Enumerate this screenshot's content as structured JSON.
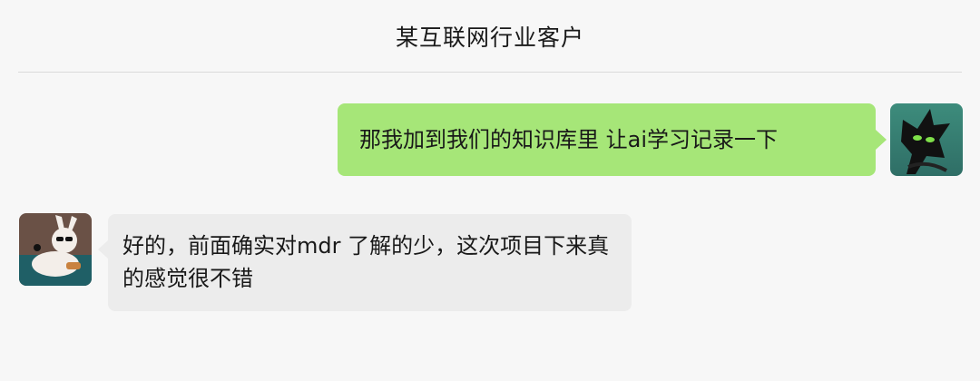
{
  "header": {
    "title": "某互联网行业客户"
  },
  "messages": [
    {
      "side": "right",
      "avatar": "alien-character-avatar",
      "text": "那我加到我们的知识库里 让ai学习记录一下"
    },
    {
      "side": "left",
      "avatar": "rabbit-sunglasses-avatar",
      "text": "好的，前面确实对mdr 了解的少，这次项目下来真的感觉很不错"
    }
  ],
  "colors": {
    "outgoing_bubble": "#a6e678",
    "incoming_bubble": "#ececec",
    "background": "#f7f7f7"
  }
}
